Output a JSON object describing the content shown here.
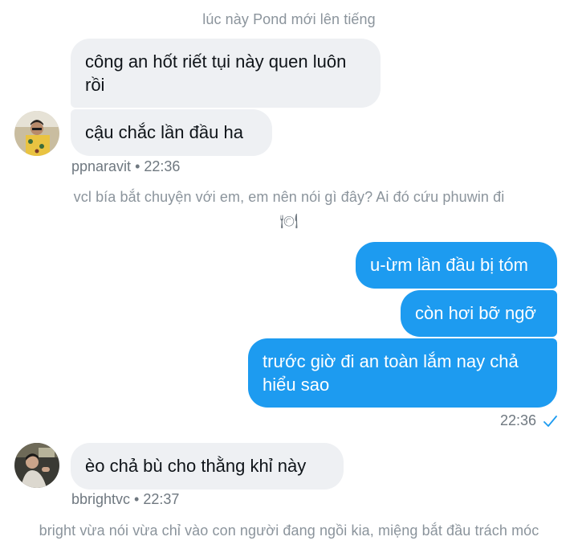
{
  "chat": {
    "narration_1": "lúc này Pond mới lên tiếng",
    "narration_2": "vcl bía bắt chuyện với em, em nên nói gì đây? Ai đó cứu phuwin đi",
    "narration_2_emoji": "🍽",
    "narration_3": "bright vừa nói vừa chỉ vào con người đang ngồi kia, miệng bắt đầu trách móc",
    "messages": [
      {
        "sender": "ppnaravit",
        "direction": "incoming",
        "text": "công an hốt riết tụi này quen luôn rồi"
      },
      {
        "sender": "ppnaravit",
        "direction": "incoming",
        "text": "cậu chắc lần đầu ha"
      },
      {
        "sender": "me",
        "direction": "outgoing",
        "text": "u-ừm lần đầu bị tóm"
      },
      {
        "sender": "me",
        "direction": "outgoing",
        "text": "còn hơi bỡ ngỡ"
      },
      {
        "sender": "me",
        "direction": "outgoing",
        "text": "trước giờ đi an toàn lắm nay chả hiểu sao"
      },
      {
        "sender": "bbrightvc",
        "direction": "incoming",
        "text": "èo chả bù cho thằng khỉ này"
      }
    ],
    "meta_1": {
      "username": "ppnaravit",
      "separator": "•",
      "time": "22:36"
    },
    "meta_2": {
      "time": "22:36",
      "status_icon": "read-check-icon"
    },
    "meta_3": {
      "username": "bbrightvc",
      "separator": "•",
      "time": "22:37"
    },
    "colors": {
      "outgoing_bubble": "#1d9bf0",
      "incoming_bubble": "#eef0f3",
      "meta_text": "#6f7880"
    }
  }
}
